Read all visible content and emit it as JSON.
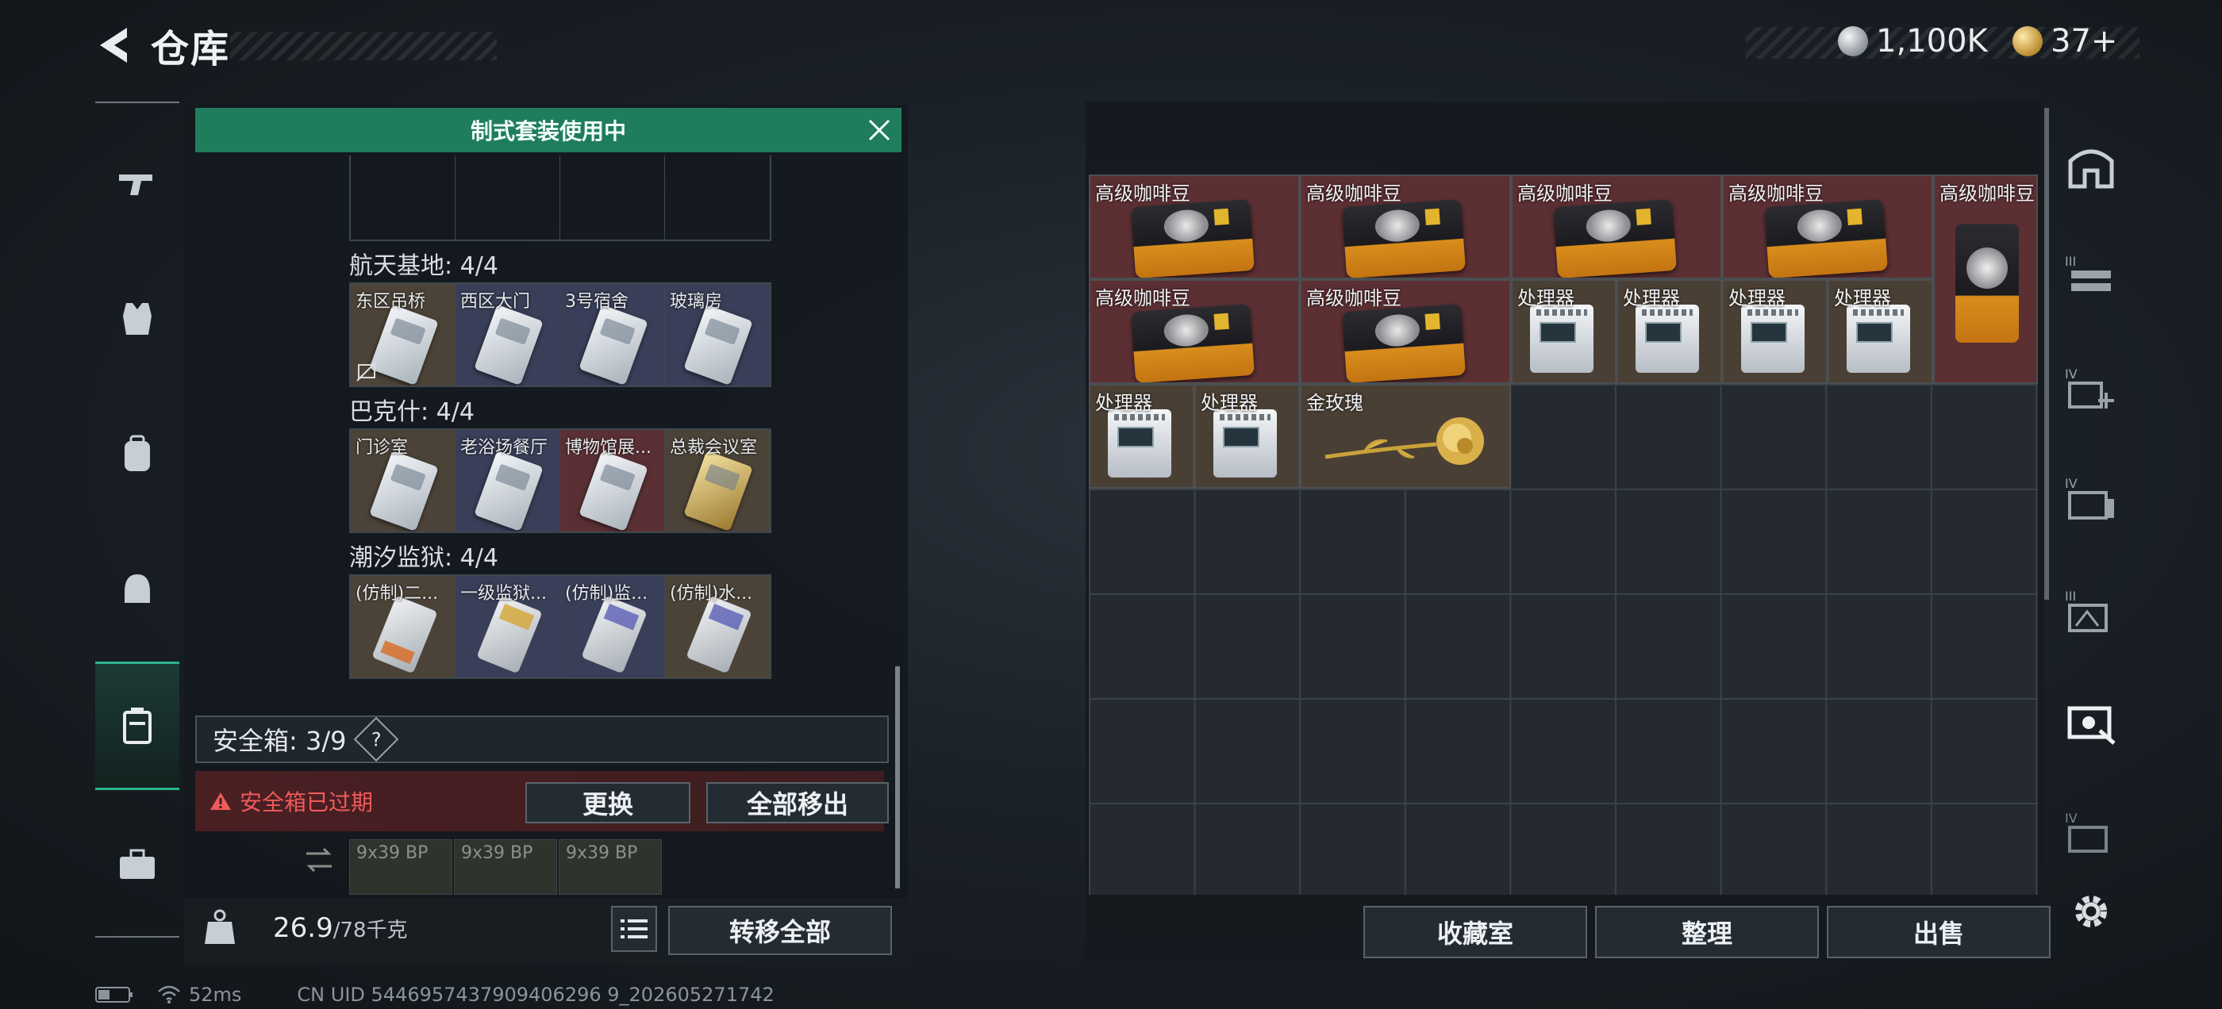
{
  "header": {
    "title": "仓库",
    "currency_silver": "1,100K",
    "currency_gold": "37+"
  },
  "nav": {
    "items": [
      "weapon",
      "armor",
      "backpack",
      "rig",
      "safebox",
      "tools"
    ],
    "active": "safebox"
  },
  "kit_banner": "制式套装使用中",
  "key_groups": [
    {
      "title": "航天基地: 4/4",
      "cells": [
        "东区吊桥",
        "西区大门",
        "3号宿舍",
        "玻璃房"
      ]
    },
    {
      "title": "巴克什: 4/4",
      "cells": [
        "门诊室",
        "老浴场餐厅",
        "博物馆展...",
        "总裁会议室"
      ]
    },
    {
      "title": "潮汐监狱: 4/4",
      "cells": [
        "(仿制)二...",
        "一级监狱...",
        "(仿制)监...",
        "(仿制)水..."
      ]
    }
  ],
  "safebox": {
    "label": "安全箱: 3/9",
    "help": "?",
    "expired_warning": "安全箱已过期",
    "replace_button": "更换",
    "move_all_out_button": "全部移出"
  },
  "ammo": [
    "9x39 BP",
    "9x39 BP",
    "9x39 BP"
  ],
  "bottom_left": {
    "weight_current": "26.9",
    "weight_max": "/78千克",
    "weight_icon_text": "KG",
    "transfer_all_button": "转移全部"
  },
  "stash_items": {
    "coffee": "高级咖啡豆",
    "processor": "处理器",
    "rose": "金玫瑰"
  },
  "stash_buttons": {
    "collection": "收藏室",
    "sort": "整理",
    "sell": "出售"
  },
  "status_bar": {
    "ping": "52ms",
    "uid": "CN UID 5446957437909406296 9_202605271742"
  },
  "colors": {
    "accent_green": "#1f7d5e",
    "coffee_bg": "#5c2f33",
    "processor_bg": "#4a3f34",
    "warning_red": "#ef5a5a"
  }
}
